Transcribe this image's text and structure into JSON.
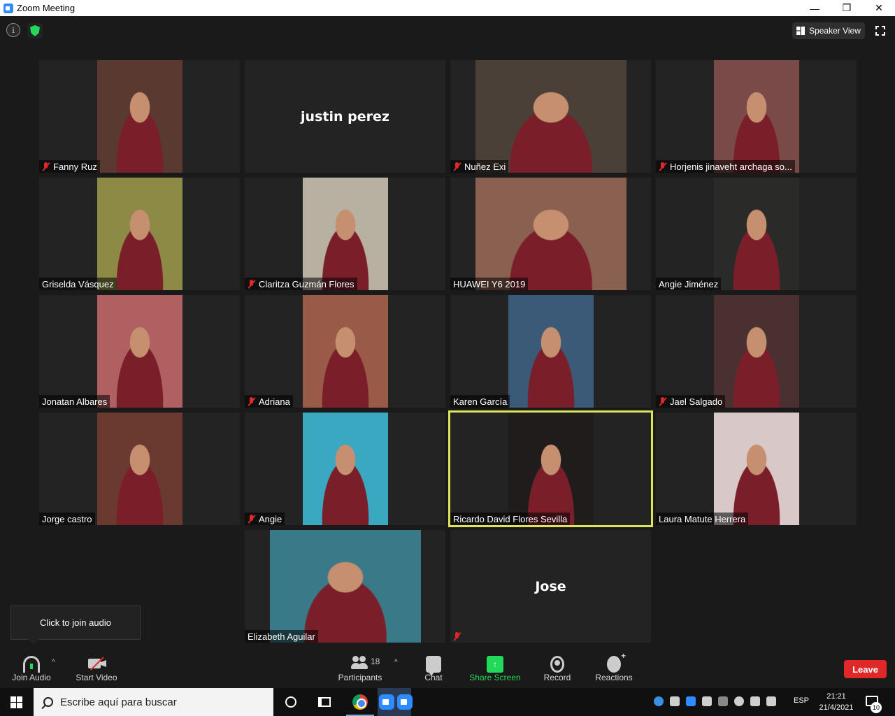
{
  "window": {
    "title": "Zoom Meeting",
    "minimize": "—",
    "restore": "❐",
    "close": "✕"
  },
  "topbar": {
    "info_icon": "i",
    "view_label": "Speaker View"
  },
  "tiles": [
    {
      "name": "Fanny Ruz",
      "muted": true,
      "video": true,
      "bg": "#5a3a30"
    },
    {
      "name": "justin perez",
      "muted": false,
      "video": false
    },
    {
      "name": "Nuñez Exi",
      "muted": true,
      "video": true,
      "bg": "#4a4038"
    },
    {
      "name": "Horjenis jinaveht archaga so...",
      "muted": true,
      "video": true,
      "bg": "#7a4a48"
    },
    {
      "name": "Griselda Vásquez",
      "muted": false,
      "video": true,
      "bg": "#8c8a45"
    },
    {
      "name": "Claritza Guzmán Flores",
      "muted": true,
      "video": true,
      "bg": "#b8b0a0"
    },
    {
      "name": "HUAWEI Y6 2019",
      "muted": false,
      "video": true,
      "bg": "#8a6050"
    },
    {
      "name": "Angie Jiménez",
      "muted": false,
      "video": true,
      "bg": "#2a2a28"
    },
    {
      "name": "Jonatan Albares",
      "muted": false,
      "video": true,
      "bg": "#b06060"
    },
    {
      "name": "Adriana",
      "muted": true,
      "video": true,
      "bg": "#9a5a48"
    },
    {
      "name": "Karen García",
      "muted": false,
      "video": true,
      "bg": "#3a5a78"
    },
    {
      "name": "Jael Salgado",
      "muted": true,
      "video": true,
      "bg": "#4a3030"
    },
    {
      "name": "Jorge castro",
      "muted": false,
      "video": true,
      "bg": "#6a3a30"
    },
    {
      "name": "Angie",
      "muted": true,
      "video": true,
      "bg": "#3aa8c0"
    },
    {
      "name": "Ricardo David Flores Sevilla",
      "muted": false,
      "video": true,
      "bg": "#201c1c",
      "active": true
    },
    {
      "name": "Laura Matute Herrera",
      "muted": false,
      "video": true,
      "bg": "#d8c8c8"
    },
    {
      "name": "Elizabeth Aguilar",
      "muted": false,
      "video": true,
      "bg": "#3a7a88"
    },
    {
      "name": "Jose",
      "muted": true,
      "video": false
    }
  ],
  "tooltip": "Click to join audio",
  "toolbar": {
    "join_audio": "Join Audio",
    "start_video": "Start Video",
    "participants": "Participants",
    "participants_count": "18",
    "chat": "Chat",
    "share_screen": "Share Screen",
    "record": "Record",
    "reactions": "Reactions",
    "leave": "Leave",
    "caret": "^"
  },
  "taskbar": {
    "search_placeholder": "Escribe aquí para buscar",
    "language": "ESP",
    "time": "21:21",
    "date": "21/4/2021",
    "notification_count": "10"
  },
  "colors": {
    "active_speaker": "#dce558",
    "muted": "#e02828",
    "share_green": "#23d959",
    "leave_red": "#e02828"
  }
}
